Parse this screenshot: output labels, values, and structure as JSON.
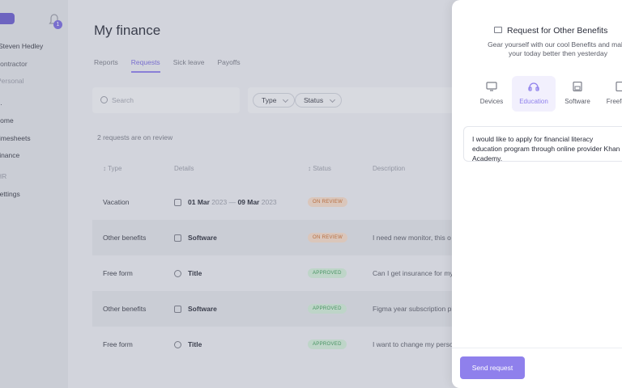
{
  "sidebar": {
    "user_name": "Steven Hedley",
    "user_role": "Contractor",
    "notif_count": "1",
    "section_personal": "Personal",
    "items": [
      "Home",
      "Timesheets",
      "Finance"
    ],
    "section_hr": "HR",
    "settings": "Settings"
  },
  "main": {
    "title": "My finance",
    "tabs": [
      "Reports",
      "Requests",
      "Sick leave",
      "Payoffs"
    ],
    "active_tab": "Requests",
    "search_placeholder": "Search",
    "filters": [
      "Type",
      "Status"
    ],
    "review_count": "2 requests are on review",
    "columns": [
      "Type",
      "Details",
      "Status",
      "Description"
    ],
    "rows": [
      {
        "type": "Vacation",
        "detail_main": "01 Mar",
        "detail_light1": " 2023 — ",
        "detail_main2": "09 Mar",
        "detail_light2": " 2023",
        "status": "ON REVIEW",
        "desc": ""
      },
      {
        "type": "Other benefits",
        "detail_main": "Software",
        "status": "ON REVIEW",
        "desc": "I need new monitor, this o"
      },
      {
        "type": "Free form",
        "detail_main": "Title",
        "status": "APPROVED",
        "desc": "Can I get insurance for my"
      },
      {
        "type": "Other benefits",
        "detail_main": "Software",
        "status": "APPROVED",
        "desc": "Figma year subscription pl"
      },
      {
        "type": "Free form",
        "detail_main": "Title",
        "status": "APPROVED",
        "desc": "I want to change my perso"
      }
    ]
  },
  "panel": {
    "title": "Request for Other Benefits",
    "subtitle": "Gear yourself with our cool Benefits and make your today better then yesterday",
    "categories": [
      "Devices",
      "Education",
      "Software",
      "Freeform"
    ],
    "active_category": "Education",
    "request_text": "I would like to apply for financial literacy education program through online provider Khan Academy.",
    "send_label": "Send request"
  },
  "colors": {
    "accent": "#8f80ec",
    "review_badge": "#f7dcc8",
    "approved_badge": "#d2efd9"
  }
}
